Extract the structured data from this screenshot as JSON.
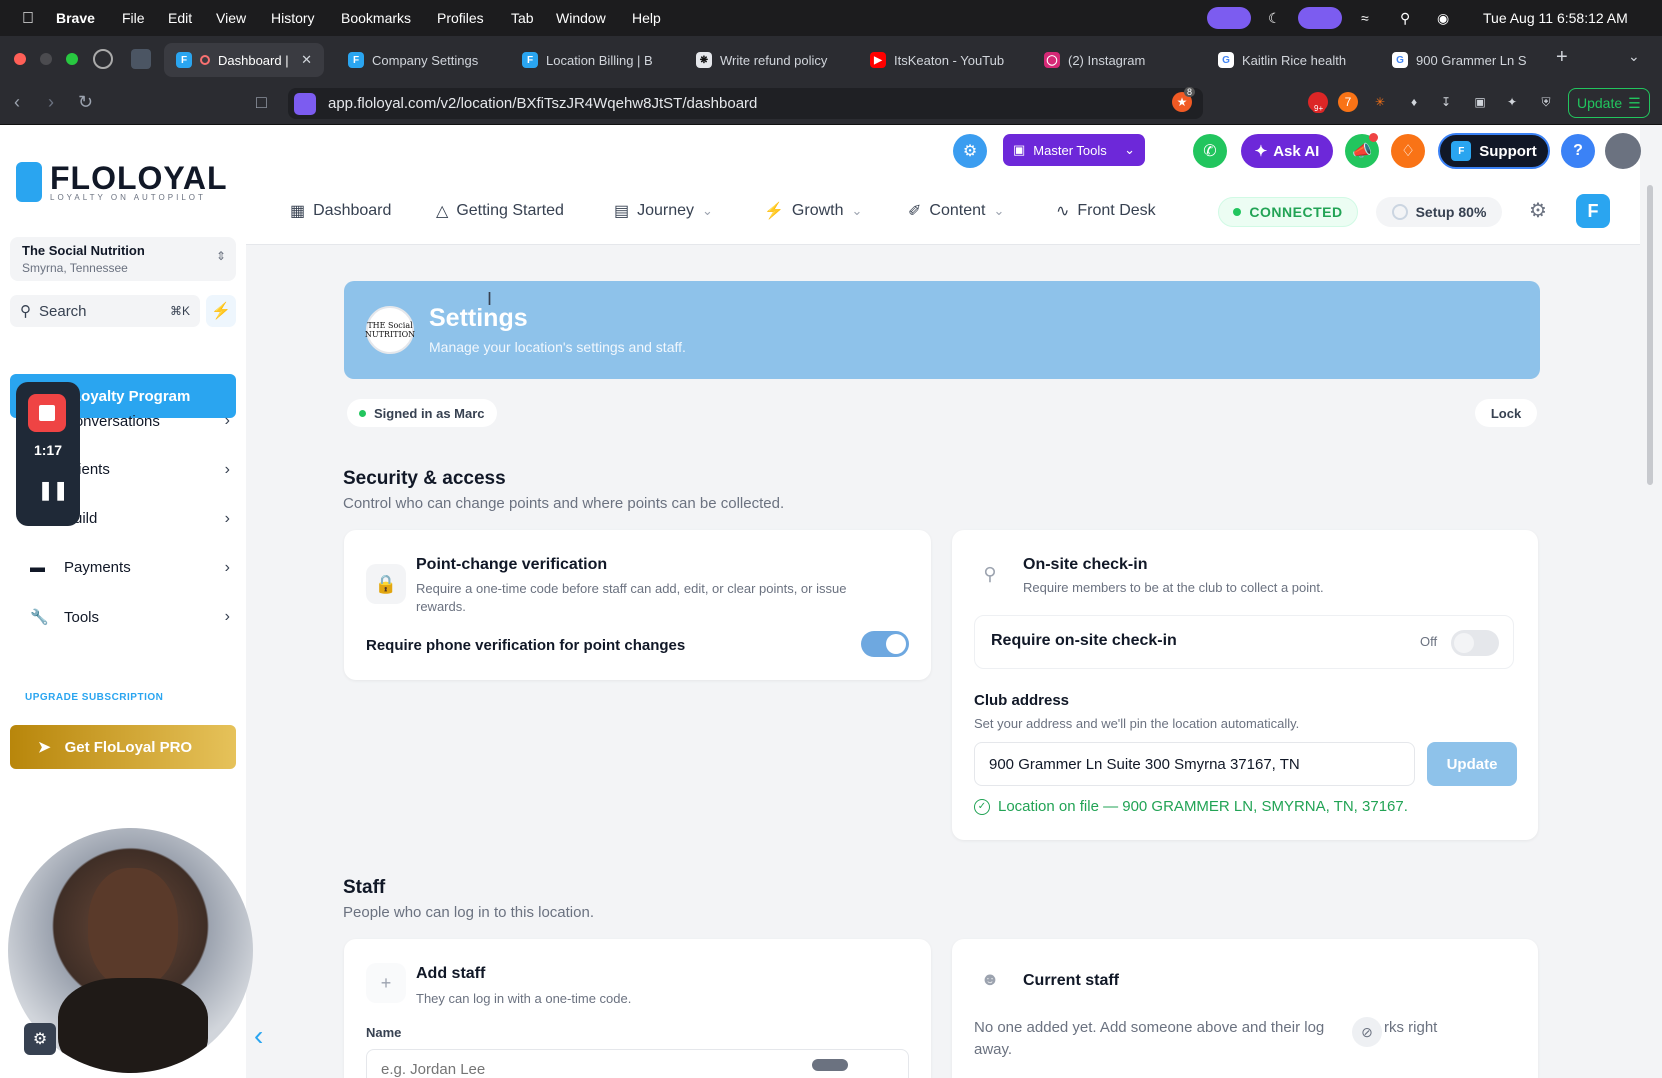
{
  "os_menu": {
    "app_name": "Brave",
    "items": [
      "File",
      "Edit",
      "View",
      "History",
      "Bookmarks",
      "Profiles",
      "Tab",
      "Window",
      "Help"
    ],
    "datetime": "Tue Aug 11  6:58:12 AM"
  },
  "browser": {
    "tabs": [
      {
        "label": "Dashboard |",
        "icon": "floloyal-icon",
        "color": "#2aa5f0"
      },
      {
        "label": "Company Settings",
        "icon": "floloyal-icon",
        "color": "#2aa5f0"
      },
      {
        "label": "Location Billing | B",
        "icon": "floloyal-icon",
        "color": "#2aa5f0"
      },
      {
        "label": "Write refund policy",
        "icon": "openai-icon",
        "color": "#e5e7eb"
      },
      {
        "label": "ItsKeaton - YouTub",
        "icon": "youtube-icon",
        "color": "#ff0000"
      },
      {
        "label": "(2) Instagram",
        "icon": "instagram-icon",
        "color": "#d62976"
      },
      {
        "label": "Kaitlin Rice health",
        "icon": "google-icon",
        "color": "#ffffff"
      },
      {
        "label": "900 Grammer Ln S",
        "icon": "google-icon",
        "color": "#ffffff"
      }
    ],
    "url": "app.floloyal.com/v2/location/BXfiTszJR4Wqehw8JtST/dashboard",
    "update_label": "Update",
    "brave_badge": "8",
    "ext_badge": "9+"
  },
  "topbar": {
    "master_tools": "Master Tools",
    "ask_ai": "Ask AI",
    "support": "Support",
    "help": "?"
  },
  "nav": {
    "items": [
      {
        "label": "Dashboard",
        "icon": "grid-icon",
        "dropdown": false
      },
      {
        "label": "Getting Started",
        "icon": "graduation-cap-icon",
        "dropdown": false
      },
      {
        "label": "Journey",
        "icon": "map-icon",
        "dropdown": true
      },
      {
        "label": "Growth",
        "icon": "lightning-icon",
        "dropdown": true
      },
      {
        "label": "Content",
        "icon": "brush-icon",
        "dropdown": true
      },
      {
        "label": "Front Desk",
        "icon": "activity-icon",
        "dropdown": false
      }
    ],
    "connected": "CONNECTED",
    "setup": "Setup 80%",
    "setup_progress": 0.8
  },
  "sidebar": {
    "logo_text": "FLOLOYAL",
    "logo_tagline": "LOYALTY ON AUTOPILOT",
    "location_name": "The Social Nutrition",
    "location_city": "Smyrna, Tennessee",
    "search_placeholder": "Search",
    "search_shortcut": "⌘K",
    "items": [
      {
        "label": "Loyalty Program",
        "active": true
      },
      {
        "label": "Conversations"
      },
      {
        "label": "Clients"
      },
      {
        "label": "Build"
      },
      {
        "label": "Payments"
      },
      {
        "label": "Tools"
      }
    ],
    "upgrade_label": "UPGRADE SUBSCRIPTION",
    "pro_button": "Get FloLoyal PRO"
  },
  "recorder": {
    "time": "1:17"
  },
  "banner": {
    "title": "Settings",
    "subtitle": "Manage your location's settings and staff.",
    "logo_text": "THE Social NUTRITION"
  },
  "status": {
    "signed_in": "Signed in as Marc",
    "lock": "Lock"
  },
  "security": {
    "title": "Security & access",
    "subtitle": "Control who can change points and where points can be collected.",
    "verification": {
      "title": "Point-change verification",
      "desc": "Require a one-time code before staff can add, edit, or clear points, or issue rewards.",
      "toggle_label": "Require phone verification for point changes",
      "enabled": true
    },
    "checkin": {
      "title": "On-site check-in",
      "desc": "Require members to be at the club to collect a point.",
      "toggle_label": "Require on-site check-in",
      "state_label": "Off",
      "enabled": false
    },
    "address": {
      "title": "Club address",
      "desc": "Set your address and we'll pin the location automatically.",
      "value": "900 Grammer Ln Suite 300 Smyrna 37167, TN",
      "update_button": "Update",
      "on_file": "Location on file — 900 GRAMMER LN, SMYRNA, TN, 37167."
    }
  },
  "staff": {
    "title": "Staff",
    "subtitle": "People who can log in to this location.",
    "add": {
      "title": "Add staff",
      "desc": "They can log in with a one-time code.",
      "name_label": "Name",
      "name_placeholder": "e.g. Jordan Lee"
    },
    "current": {
      "title": "Current staff",
      "empty": "No one added yet. Add someone above and their log... works right away.",
      "empty_line1": "No one added yet. Add someone above and their log",
      "empty_line1b": "rks right",
      "empty_line2": "away."
    }
  },
  "colors": {
    "accent": "#2aa5f0",
    "banner": "#8ec2ea",
    "green": "#22a355",
    "pro_gold": "#d4a72c",
    "purple": "#6d28d9"
  }
}
